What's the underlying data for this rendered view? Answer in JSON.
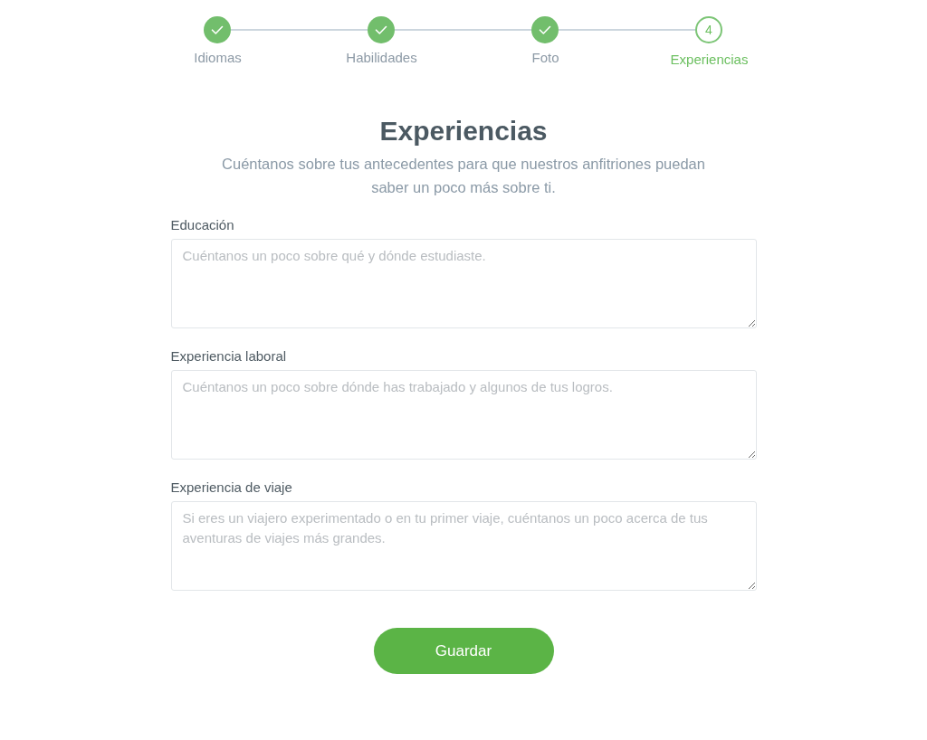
{
  "steps": [
    {
      "label": "Idiomas",
      "kind": "done"
    },
    {
      "label": "Habilidades",
      "kind": "done"
    },
    {
      "label": "Foto",
      "kind": "done"
    },
    {
      "label": "Experiencias",
      "kind": "current",
      "number": "4"
    }
  ],
  "heading": {
    "title": "Experiencias",
    "subtitle": "Cuéntanos sobre tus antecedentes para que nuestros anfitriones puedan saber un poco más sobre ti."
  },
  "fields": [
    {
      "label": "Educación",
      "placeholder": "Cuéntanos un poco sobre qué y dónde estudiaste."
    },
    {
      "label": "Experiencia laboral",
      "placeholder": "Cuéntanos un poco sobre dónde has trabajado y algunos de tus logros."
    },
    {
      "label": "Experiencia de viaje",
      "placeholder": "Si eres un viajero experimentado o en tu primer viaje, cuéntanos un poco acerca de tus aventuras de viajes más grandes."
    }
  ],
  "save_button": {
    "label": "Guardar"
  }
}
